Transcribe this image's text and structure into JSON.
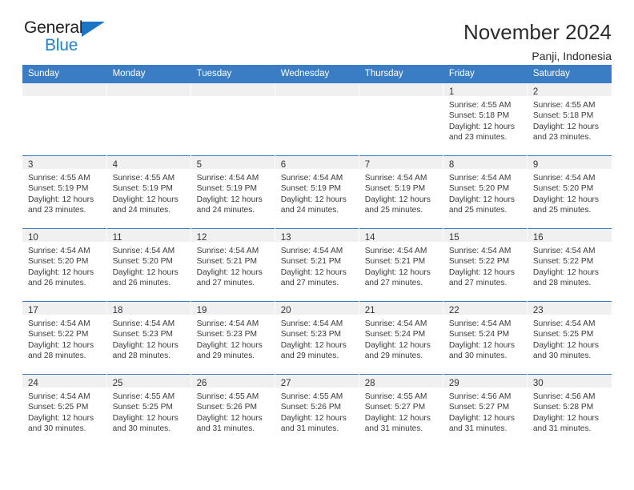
{
  "brand": {
    "name_dark": "General",
    "name_blue": "Blue",
    "accent_color": "#1b7ad4",
    "header_color": "#3b7dc4"
  },
  "header": {
    "title": "November 2024",
    "subtitle": "Panji, Indonesia"
  },
  "weekday_headers": [
    "Sunday",
    "Monday",
    "Tuesday",
    "Wednesday",
    "Thursday",
    "Friday",
    "Saturday"
  ],
  "labels": {
    "sunrise_prefix": "Sunrise:",
    "sunset_prefix": "Sunset:",
    "daylight_prefix": "Daylight:"
  },
  "weeks": [
    [
      {
        "day": "",
        "empty": true
      },
      {
        "day": "",
        "empty": true
      },
      {
        "day": "",
        "empty": true
      },
      {
        "day": "",
        "empty": true
      },
      {
        "day": "",
        "empty": true
      },
      {
        "day": "1",
        "sunrise": "Sunrise: 4:55 AM",
        "sunset": "Sunset: 5:18 PM",
        "daylight_1": "Daylight: 12 hours",
        "daylight_2": "and 23 minutes."
      },
      {
        "day": "2",
        "sunrise": "Sunrise: 4:55 AM",
        "sunset": "Sunset: 5:18 PM",
        "daylight_1": "Daylight: 12 hours",
        "daylight_2": "and 23 minutes."
      }
    ],
    [
      {
        "day": "3",
        "sunrise": "Sunrise: 4:55 AM",
        "sunset": "Sunset: 5:19 PM",
        "daylight_1": "Daylight: 12 hours",
        "daylight_2": "and 23 minutes."
      },
      {
        "day": "4",
        "sunrise": "Sunrise: 4:55 AM",
        "sunset": "Sunset: 5:19 PM",
        "daylight_1": "Daylight: 12 hours",
        "daylight_2": "and 24 minutes."
      },
      {
        "day": "5",
        "sunrise": "Sunrise: 4:54 AM",
        "sunset": "Sunset: 5:19 PM",
        "daylight_1": "Daylight: 12 hours",
        "daylight_2": "and 24 minutes."
      },
      {
        "day": "6",
        "sunrise": "Sunrise: 4:54 AM",
        "sunset": "Sunset: 5:19 PM",
        "daylight_1": "Daylight: 12 hours",
        "daylight_2": "and 24 minutes."
      },
      {
        "day": "7",
        "sunrise": "Sunrise: 4:54 AM",
        "sunset": "Sunset: 5:19 PM",
        "daylight_1": "Daylight: 12 hours",
        "daylight_2": "and 25 minutes."
      },
      {
        "day": "8",
        "sunrise": "Sunrise: 4:54 AM",
        "sunset": "Sunset: 5:20 PM",
        "daylight_1": "Daylight: 12 hours",
        "daylight_2": "and 25 minutes."
      },
      {
        "day": "9",
        "sunrise": "Sunrise: 4:54 AM",
        "sunset": "Sunset: 5:20 PM",
        "daylight_1": "Daylight: 12 hours",
        "daylight_2": "and 25 minutes."
      }
    ],
    [
      {
        "day": "10",
        "sunrise": "Sunrise: 4:54 AM",
        "sunset": "Sunset: 5:20 PM",
        "daylight_1": "Daylight: 12 hours",
        "daylight_2": "and 26 minutes."
      },
      {
        "day": "11",
        "sunrise": "Sunrise: 4:54 AM",
        "sunset": "Sunset: 5:20 PM",
        "daylight_1": "Daylight: 12 hours",
        "daylight_2": "and 26 minutes."
      },
      {
        "day": "12",
        "sunrise": "Sunrise: 4:54 AM",
        "sunset": "Sunset: 5:21 PM",
        "daylight_1": "Daylight: 12 hours",
        "daylight_2": "and 27 minutes."
      },
      {
        "day": "13",
        "sunrise": "Sunrise: 4:54 AM",
        "sunset": "Sunset: 5:21 PM",
        "daylight_1": "Daylight: 12 hours",
        "daylight_2": "and 27 minutes."
      },
      {
        "day": "14",
        "sunrise": "Sunrise: 4:54 AM",
        "sunset": "Sunset: 5:21 PM",
        "daylight_1": "Daylight: 12 hours",
        "daylight_2": "and 27 minutes."
      },
      {
        "day": "15",
        "sunrise": "Sunrise: 4:54 AM",
        "sunset": "Sunset: 5:22 PM",
        "daylight_1": "Daylight: 12 hours",
        "daylight_2": "and 27 minutes."
      },
      {
        "day": "16",
        "sunrise": "Sunrise: 4:54 AM",
        "sunset": "Sunset: 5:22 PM",
        "daylight_1": "Daylight: 12 hours",
        "daylight_2": "and 28 minutes."
      }
    ],
    [
      {
        "day": "17",
        "sunrise": "Sunrise: 4:54 AM",
        "sunset": "Sunset: 5:22 PM",
        "daylight_1": "Daylight: 12 hours",
        "daylight_2": "and 28 minutes."
      },
      {
        "day": "18",
        "sunrise": "Sunrise: 4:54 AM",
        "sunset": "Sunset: 5:23 PM",
        "daylight_1": "Daylight: 12 hours",
        "daylight_2": "and 28 minutes."
      },
      {
        "day": "19",
        "sunrise": "Sunrise: 4:54 AM",
        "sunset": "Sunset: 5:23 PM",
        "daylight_1": "Daylight: 12 hours",
        "daylight_2": "and 29 minutes."
      },
      {
        "day": "20",
        "sunrise": "Sunrise: 4:54 AM",
        "sunset": "Sunset: 5:23 PM",
        "daylight_1": "Daylight: 12 hours",
        "daylight_2": "and 29 minutes."
      },
      {
        "day": "21",
        "sunrise": "Sunrise: 4:54 AM",
        "sunset": "Sunset: 5:24 PM",
        "daylight_1": "Daylight: 12 hours",
        "daylight_2": "and 29 minutes."
      },
      {
        "day": "22",
        "sunrise": "Sunrise: 4:54 AM",
        "sunset": "Sunset: 5:24 PM",
        "daylight_1": "Daylight: 12 hours",
        "daylight_2": "and 30 minutes."
      },
      {
        "day": "23",
        "sunrise": "Sunrise: 4:54 AM",
        "sunset": "Sunset: 5:25 PM",
        "daylight_1": "Daylight: 12 hours",
        "daylight_2": "and 30 minutes."
      }
    ],
    [
      {
        "day": "24",
        "sunrise": "Sunrise: 4:54 AM",
        "sunset": "Sunset: 5:25 PM",
        "daylight_1": "Daylight: 12 hours",
        "daylight_2": "and 30 minutes."
      },
      {
        "day": "25",
        "sunrise": "Sunrise: 4:55 AM",
        "sunset": "Sunset: 5:25 PM",
        "daylight_1": "Daylight: 12 hours",
        "daylight_2": "and 30 minutes."
      },
      {
        "day": "26",
        "sunrise": "Sunrise: 4:55 AM",
        "sunset": "Sunset: 5:26 PM",
        "daylight_1": "Daylight: 12 hours",
        "daylight_2": "and 31 minutes."
      },
      {
        "day": "27",
        "sunrise": "Sunrise: 4:55 AM",
        "sunset": "Sunset: 5:26 PM",
        "daylight_1": "Daylight: 12 hours",
        "daylight_2": "and 31 minutes."
      },
      {
        "day": "28",
        "sunrise": "Sunrise: 4:55 AM",
        "sunset": "Sunset: 5:27 PM",
        "daylight_1": "Daylight: 12 hours",
        "daylight_2": "and 31 minutes."
      },
      {
        "day": "29",
        "sunrise": "Sunrise: 4:56 AM",
        "sunset": "Sunset: 5:27 PM",
        "daylight_1": "Daylight: 12 hours",
        "daylight_2": "and 31 minutes."
      },
      {
        "day": "30",
        "sunrise": "Sunrise: 4:56 AM",
        "sunset": "Sunset: 5:28 PM",
        "daylight_1": "Daylight: 12 hours",
        "daylight_2": "and 31 minutes."
      }
    ]
  ]
}
